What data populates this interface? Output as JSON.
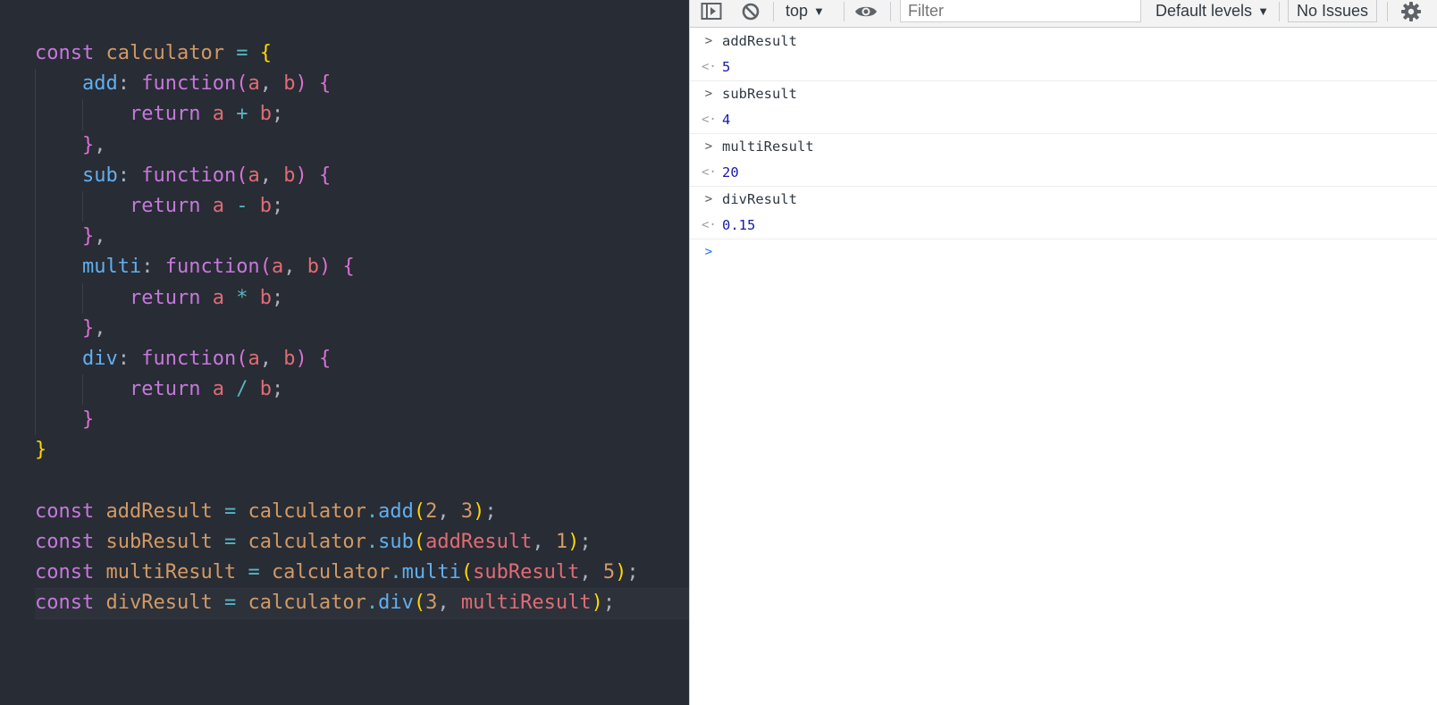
{
  "colors": {
    "editor_bg": "#282c34",
    "keyword": "#c678dd",
    "property": "#61afef",
    "param": "#e06c75",
    "number": "#d19a66",
    "console_output": "#1a1aa6",
    "prompt": "#1a73e8"
  },
  "editor": {
    "kw_const": "const",
    "kw_function": "function",
    "kw_return": "return",
    "calculator": "calculator",
    "add": "add",
    "sub": "sub",
    "multi": "multi",
    "div": "div",
    "a": "a",
    "b": "b",
    "addResult": "addResult",
    "subResult": "subResult",
    "multiResult": "multiResult",
    "divResult": "divResult",
    "n2": "2",
    "n3": "3",
    "n1": "1",
    "n5": "5"
  },
  "console": {
    "toolbar": {
      "sidebar_icon": "sidebar-toggle-icon",
      "clear_icon": "block-icon",
      "context": "top",
      "eye_icon": "eye-icon",
      "filter_placeholder": "Filter",
      "levels": "Default levels",
      "issues": "No Issues",
      "settings_icon": "gear-icon"
    },
    "entries": [
      {
        "input": "addResult",
        "output": "5"
      },
      {
        "input": "subResult",
        "output": "4"
      },
      {
        "input": "multiResult",
        "output": "20"
      },
      {
        "input": "divResult",
        "output": "0.15"
      }
    ]
  }
}
